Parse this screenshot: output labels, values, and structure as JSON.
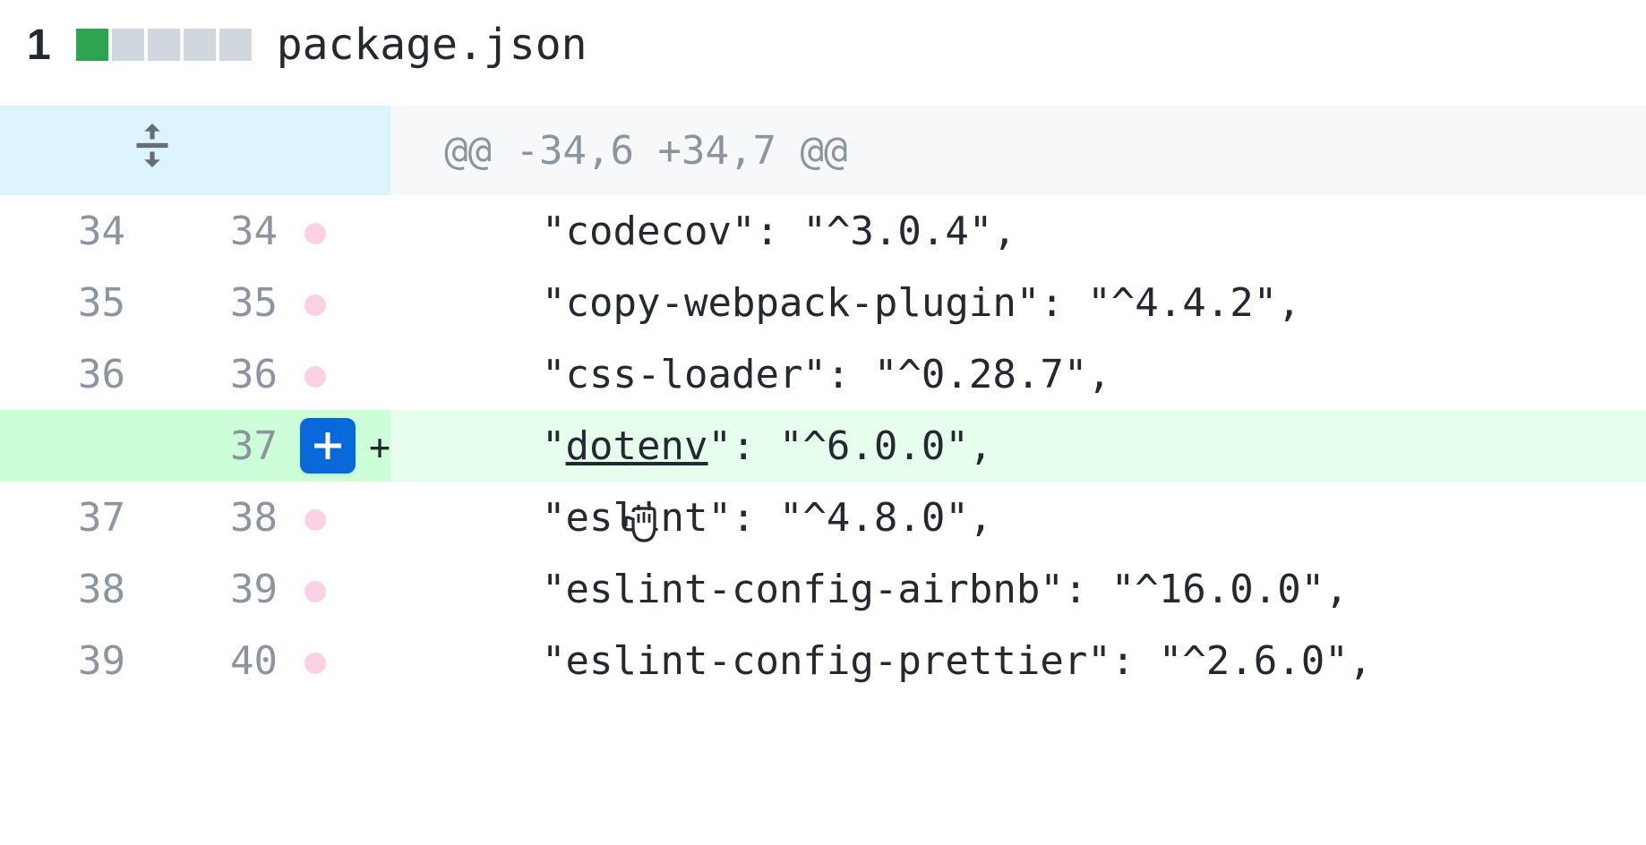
{
  "file": {
    "index": "1",
    "name": "package.json",
    "diffstat": {
      "additions": 1,
      "total_blocks": 5
    }
  },
  "hunk_header": "@@ -34,6 +34,7 @@",
  "lines": [
    {
      "old": "34",
      "new": "34",
      "type": "context",
      "marker": "dot",
      "content": "      \"codecov\": \"^3.0.4\","
    },
    {
      "old": "35",
      "new": "35",
      "type": "context",
      "marker": "dot",
      "content": "      \"copy-webpack-plugin\": \"^4.4.2\","
    },
    {
      "old": "36",
      "new": "36",
      "type": "context",
      "marker": "dot",
      "content": "      \"css-loader\": \"^0.28.7\","
    },
    {
      "old": "",
      "new": "37",
      "type": "addition",
      "marker": "plus",
      "content": "      \"dotenv\": \"^6.0.0\",",
      "underline_word": "dotenv"
    },
    {
      "old": "37",
      "new": "38",
      "type": "context",
      "marker": "dot",
      "content": "      \"eslint\": \"^4.8.0\","
    },
    {
      "old": "38",
      "new": "39",
      "type": "context",
      "marker": "dot",
      "content": "      \"eslint-config-airbnb\": \"^16.0.0\","
    },
    {
      "old": "39",
      "new": "40",
      "type": "context",
      "marker": "dot",
      "content": "      \"eslint-config-prettier\": \"^2.6.0\","
    }
  ]
}
